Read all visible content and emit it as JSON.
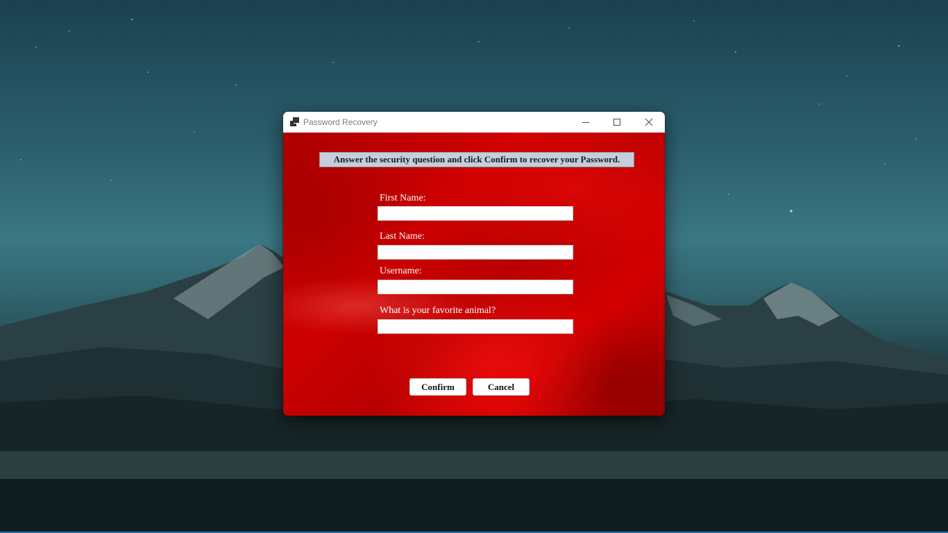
{
  "window": {
    "title": "Password Recovery",
    "icon": "app-window-icon"
  },
  "titlebar_controls": {
    "minimize_icon": "minimize-icon",
    "maximize_icon": "maximize-icon",
    "close_icon": "close-icon"
  },
  "form": {
    "instruction": "Answer the security question and click Confirm to recover your Password.",
    "fields": [
      {
        "label": "First Name:",
        "value": ""
      },
      {
        "label": "Last Name:",
        "value": ""
      },
      {
        "label": "Username:",
        "value": ""
      },
      {
        "label": "What is your favorite animal?",
        "value": ""
      }
    ],
    "confirm_label": "Confirm",
    "cancel_label": "Cancel"
  },
  "colors": {
    "background_accent": "#c00000",
    "banner": "#c4cfdb",
    "taskbar_accent": "#2a6fb0"
  }
}
